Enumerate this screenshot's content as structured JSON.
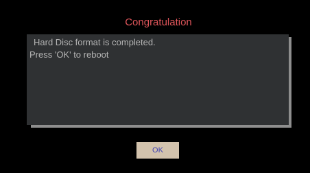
{
  "dialog": {
    "title": "Congratulation",
    "message_line_1": "Hard Disc format is completed.",
    "message_line_2": "Press 'OK' to reboot",
    "ok_label": "OK"
  },
  "colors": {
    "background": "#000000",
    "title": "#e0565b",
    "panel": "#2f3133",
    "panel_shadow": "#8e8e8e",
    "message_text": "#b4b4b4",
    "button_bg": "#d3c3ad",
    "button_text": "#3b3fb4"
  }
}
